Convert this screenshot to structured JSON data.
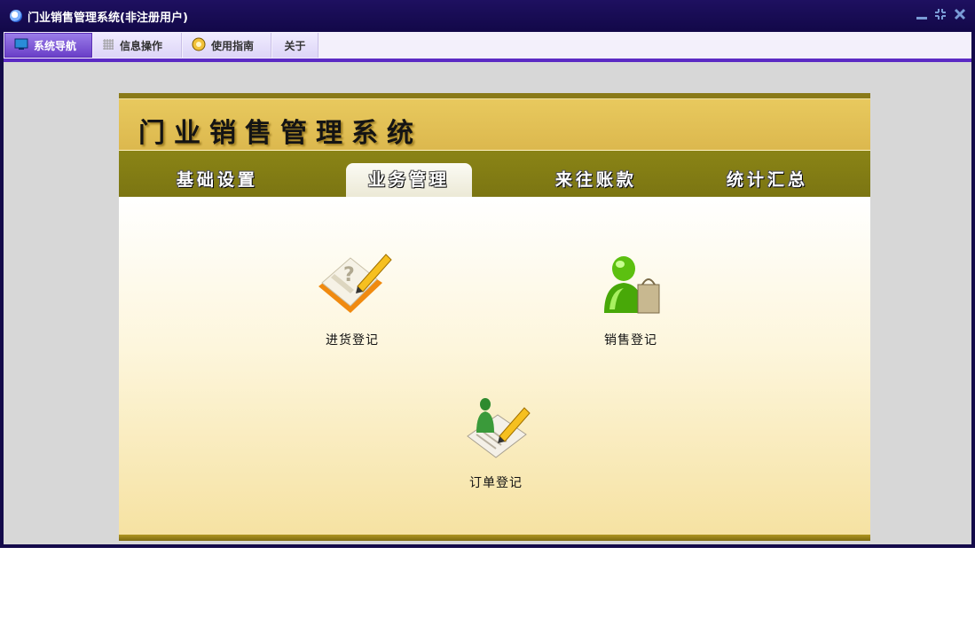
{
  "window": {
    "title": "门业销售管理系统(非注册用户)",
    "controls": {
      "minimize": "minimize-icon",
      "restore": "restore-icon",
      "close": "close-icon"
    }
  },
  "menubar": {
    "items": [
      {
        "label": "系统导航",
        "icon": "monitor-icon",
        "active": true
      },
      {
        "label": "信息操作",
        "icon": "grid-icon",
        "active": false
      },
      {
        "label": "使用指南",
        "icon": "compass-icon",
        "active": false
      },
      {
        "label": "关于",
        "icon": "",
        "active": false
      }
    ]
  },
  "panel": {
    "system_title": "门业销售管理系统",
    "tabs": [
      {
        "label": "基础设置",
        "active": false
      },
      {
        "label": "业务管理",
        "active": true
      },
      {
        "label": "来往账款",
        "active": false
      },
      {
        "label": "统计汇总",
        "active": false
      }
    ],
    "functions": [
      {
        "label": "进货登记",
        "icon": "notebook-pencil-icon"
      },
      {
        "label": "销售登记",
        "icon": "shopper-icon"
      },
      {
        "label": "订单登记",
        "icon": "order-form-icon"
      }
    ]
  },
  "colors": {
    "titlebar": "#140a4a",
    "menu_accent": "#5b2ac4",
    "header_band": "#dcb84e",
    "nav_band": "#7b7512",
    "client_bg": "#d7d7d7"
  }
}
